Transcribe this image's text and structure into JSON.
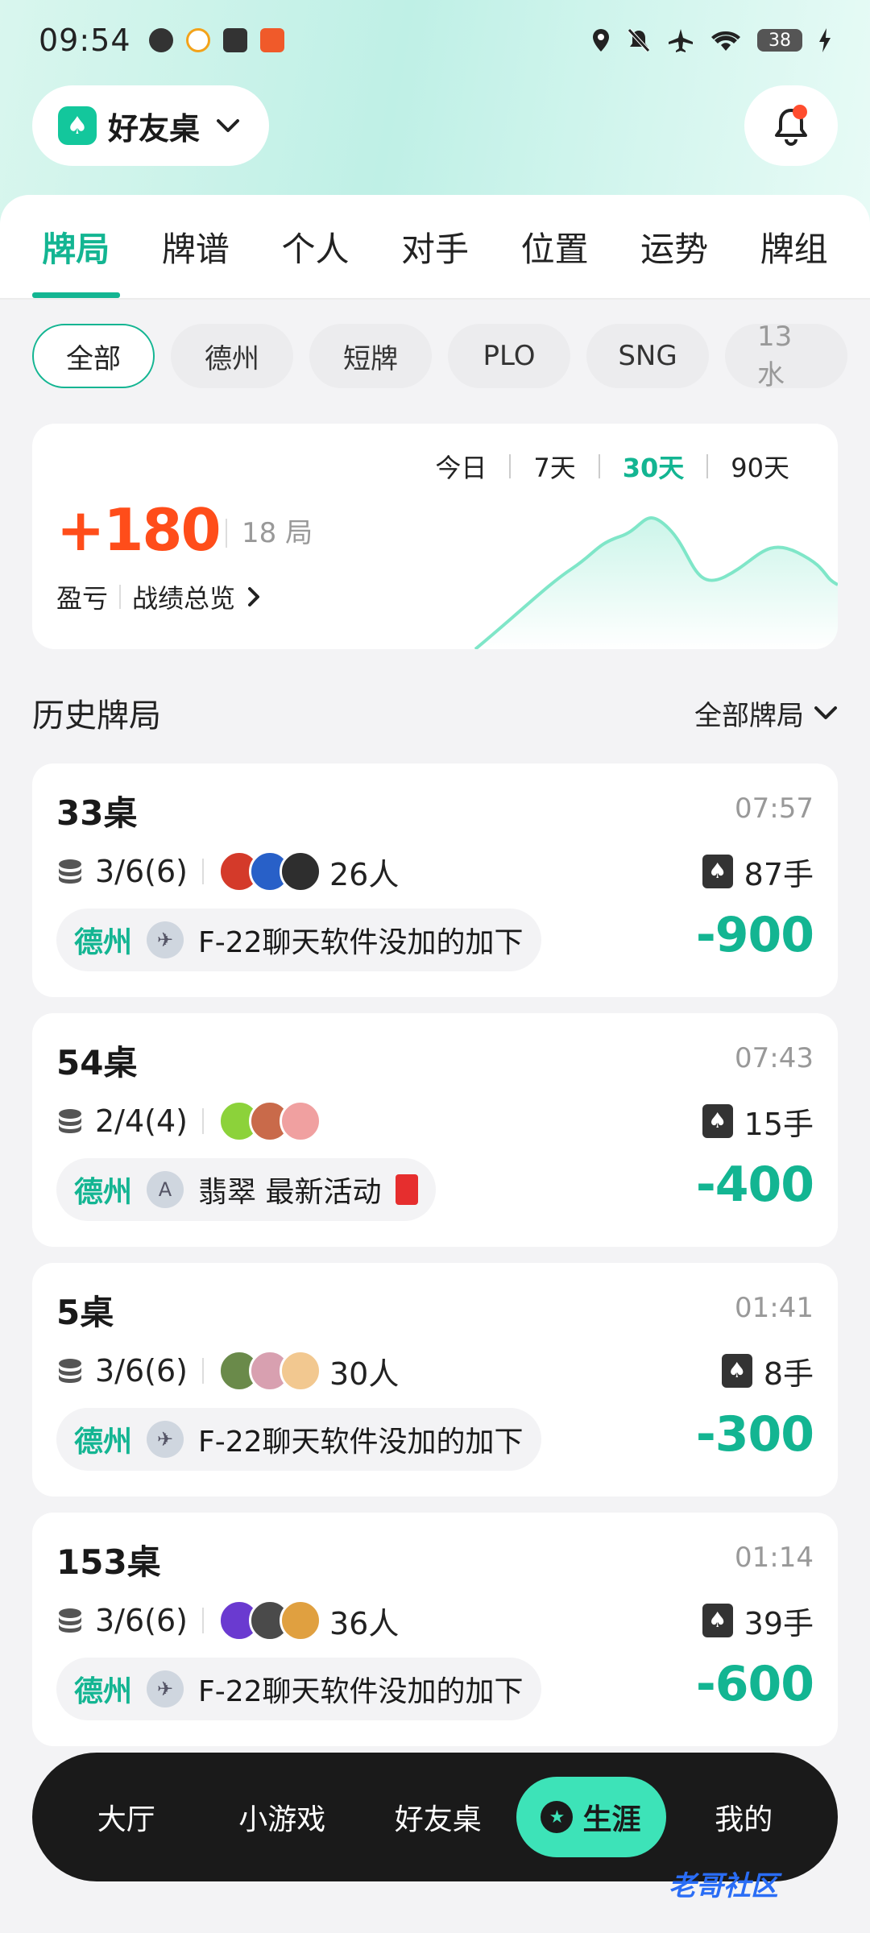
{
  "status_bar": {
    "time": "09:54",
    "battery": "38",
    "icons": [
      "wechat-icon",
      "qq-icon",
      "mail-icon",
      "app-icon",
      "location-icon",
      "mute-icon",
      "airplane-icon",
      "wifi-icon",
      "charging-icon"
    ]
  },
  "header": {
    "club_name": "好友桌",
    "notification_dot": true
  },
  "tabs": [
    {
      "label": "牌局",
      "active": true
    },
    {
      "label": "牌谱",
      "active": false
    },
    {
      "label": "个人",
      "active": false
    },
    {
      "label": "对手",
      "active": false
    },
    {
      "label": "位置",
      "active": false
    },
    {
      "label": "运势",
      "active": false
    },
    {
      "label": "牌组",
      "active": false
    }
  ],
  "filters": [
    {
      "label": "全部",
      "active": true
    },
    {
      "label": "德州",
      "active": false
    },
    {
      "label": "短牌",
      "active": false
    },
    {
      "label": "PLO",
      "active": false
    },
    {
      "label": "SNG",
      "active": false
    },
    {
      "label": "13水",
      "active": false
    }
  ],
  "summary": {
    "periods": [
      {
        "label": "今日",
        "active": false
      },
      {
        "label": "7天",
        "active": false
      },
      {
        "label": "30天",
        "active": true
      },
      {
        "label": "90天",
        "active": false
      }
    ],
    "profit": "+180",
    "sessions": "18 局",
    "label_profit": "盈亏",
    "label_overview": "战绩总览",
    "accent": "#ff4d1a"
  },
  "history": {
    "title": "历史牌局",
    "filter": "全部牌局"
  },
  "games": [
    {
      "table": "33桌",
      "time": "07:57",
      "blinds": "3/6(6)",
      "players": "26人",
      "hands": "87手",
      "type": "德州",
      "club": "F-22聊天软件没加的加下",
      "result": "-900",
      "avatar_colors": [
        "#d43a2a",
        "#2860c8",
        "#2e2e2e"
      ],
      "red_packet": false
    },
    {
      "table": "54桌",
      "time": "07:43",
      "blinds": "2/4(4)",
      "players": "",
      "hands": "15手",
      "type": "德州",
      "club": "翡翠 最新活动",
      "result": "-400",
      "avatar_colors": [
        "#8cd23a",
        "#c96a4a",
        "#f0a0a0"
      ],
      "red_packet": true
    },
    {
      "table": "5桌",
      "time": "01:41",
      "blinds": "3/6(6)",
      "players": "30人",
      "hands": "8手",
      "type": "德州",
      "club": "F-22聊天软件没加的加下",
      "result": "-300",
      "avatar_colors": [
        "#6a8a4a",
        "#d8a0b0",
        "#f2c890"
      ],
      "red_packet": false
    },
    {
      "table": "153桌",
      "time": "01:14",
      "blinds": "3/6(6)",
      "players": "36人",
      "hands": "39手",
      "type": "德州",
      "club": "F-22聊天软件没加的加下",
      "result": "-600",
      "avatar_colors": [
        "#6a3ad0",
        "#4a4a4a",
        "#e0a040"
      ],
      "red_packet": false
    }
  ],
  "bottom_nav": [
    {
      "label": "大厅",
      "active": false
    },
    {
      "label": "小游戏",
      "active": false
    },
    {
      "label": "好友桌",
      "active": false
    },
    {
      "label": "生涯",
      "active": true
    },
    {
      "label": "我的",
      "active": false
    }
  ],
  "watermark": "老哥社区",
  "colors": {
    "brand": "#13b592",
    "loss": "#13b592",
    "profit": "#ff4d1a"
  }
}
